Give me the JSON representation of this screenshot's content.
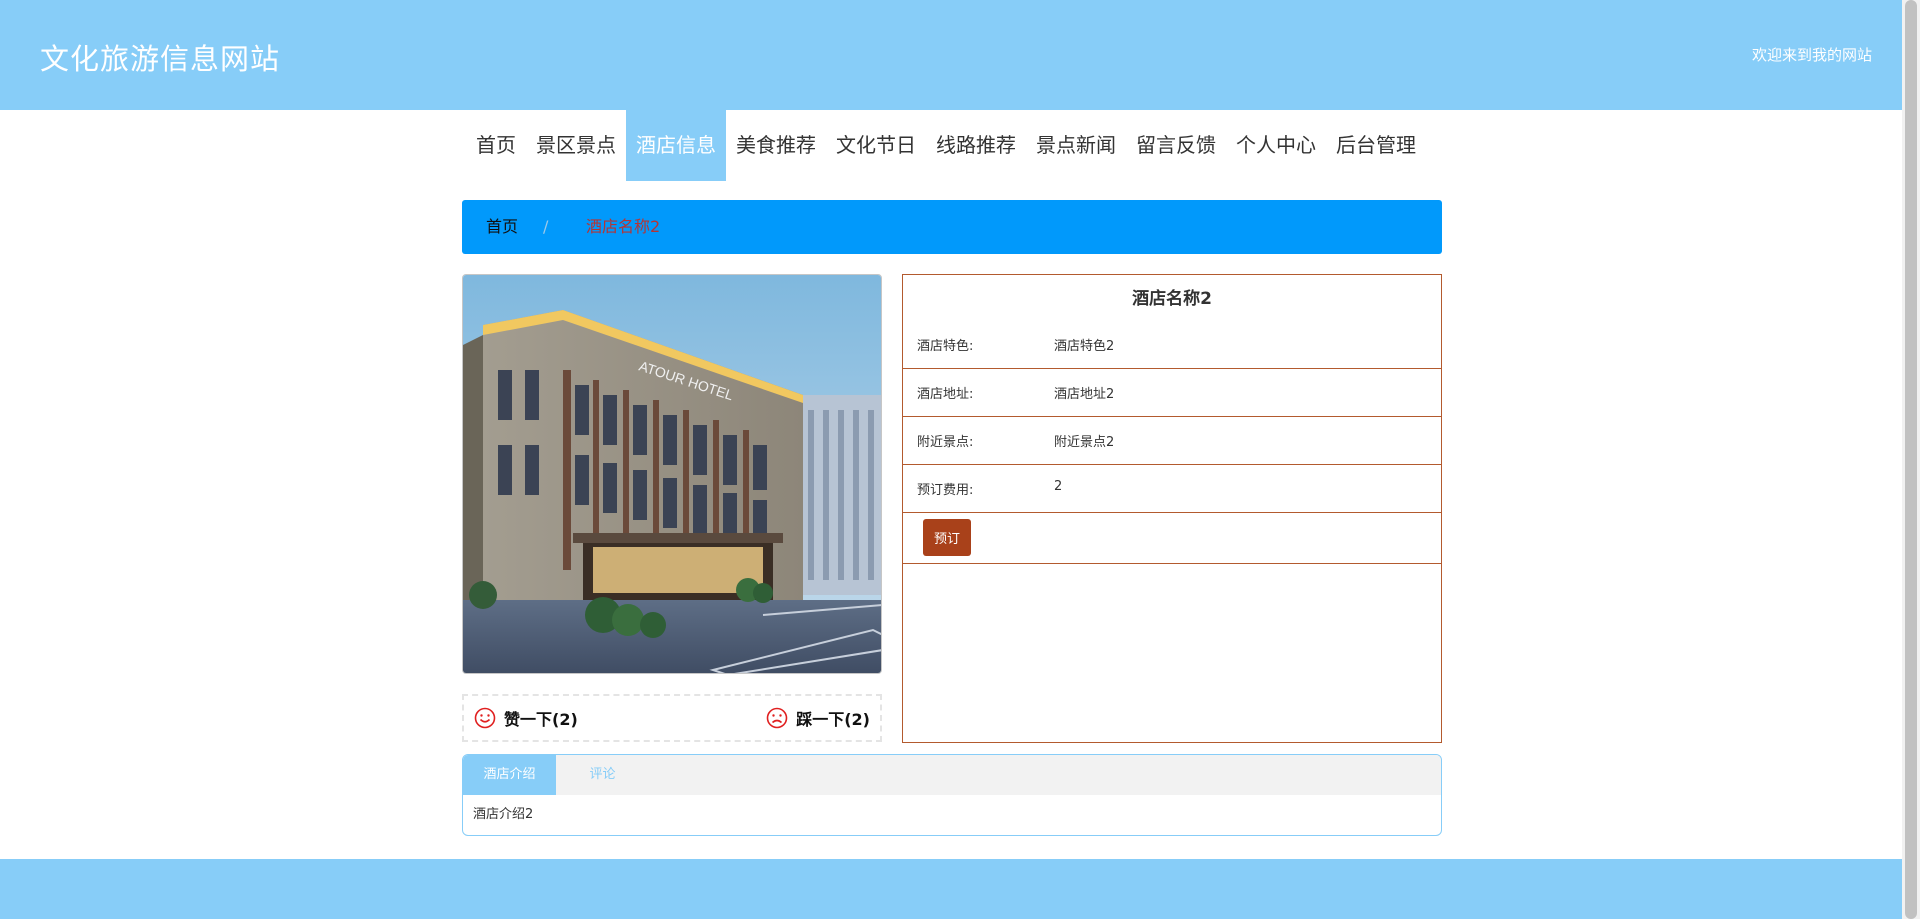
{
  "header": {
    "site_title": "文化旅游信息网站",
    "welcome": "欢迎来到我的网站"
  },
  "nav": {
    "items": [
      {
        "label": "首页"
      },
      {
        "label": "景区景点"
      },
      {
        "label": "酒店信息",
        "active": true
      },
      {
        "label": "美食推荐"
      },
      {
        "label": "文化节日"
      },
      {
        "label": "线路推荐"
      },
      {
        "label": "景点新闻"
      },
      {
        "label": "留言反馈"
      },
      {
        "label": "个人中心"
      },
      {
        "label": "后台管理"
      }
    ]
  },
  "breadcrumb": {
    "home": "首页",
    "separator": "/",
    "current": "酒店名称2"
  },
  "hotel": {
    "image_sign_text": "ATOUR HOTEL",
    "name": "酒店名称2",
    "fields": [
      {
        "label": "酒店特色:",
        "value": "酒店特色2"
      },
      {
        "label": "酒店地址:",
        "value": "酒店地址2"
      },
      {
        "label": "附近景点:",
        "value": "附近景点2"
      },
      {
        "label": "预订费用:",
        "value": "2"
      }
    ],
    "book_label": "预订"
  },
  "votes": {
    "like_label": "赞一下(2)",
    "dislike_label": "踩一下(2)"
  },
  "tabs": {
    "items": [
      {
        "label": "酒店介绍",
        "active": true
      },
      {
        "label": "评论"
      }
    ],
    "content": "酒店介绍2"
  },
  "colors": {
    "header_bg": "#87cdf8",
    "breadcrumb_bg": "#0199fb",
    "detail_border": "#b35a2e",
    "book_button": "#a9411a",
    "vote_icon": "#e02020"
  }
}
